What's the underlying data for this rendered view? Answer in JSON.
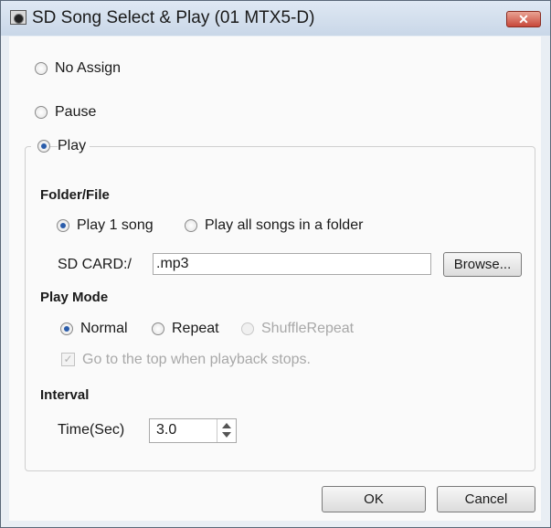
{
  "window": {
    "title": "SD Song Select & Play (01 MTX5-D)",
    "close_glyph": "✕"
  },
  "options": {
    "no_assign": "No Assign",
    "pause": "Pause",
    "play": "Play"
  },
  "folder_file": {
    "heading": "Folder/File",
    "play_1_song": "Play 1 song",
    "play_all": "Play all songs in a folder",
    "path_label": "SD CARD:/",
    "path_value": ".mp3",
    "browse": "Browse..."
  },
  "play_mode": {
    "heading": "Play Mode",
    "normal": "Normal",
    "repeat": "Repeat",
    "shuffle_repeat": "ShuffleRepeat",
    "go_top": "Go to the top when playback stops."
  },
  "interval": {
    "heading": "Interval",
    "time_label": "Time(Sec)",
    "time_value": "3.0"
  },
  "buttons": {
    "ok": "OK",
    "cancel": "Cancel"
  }
}
